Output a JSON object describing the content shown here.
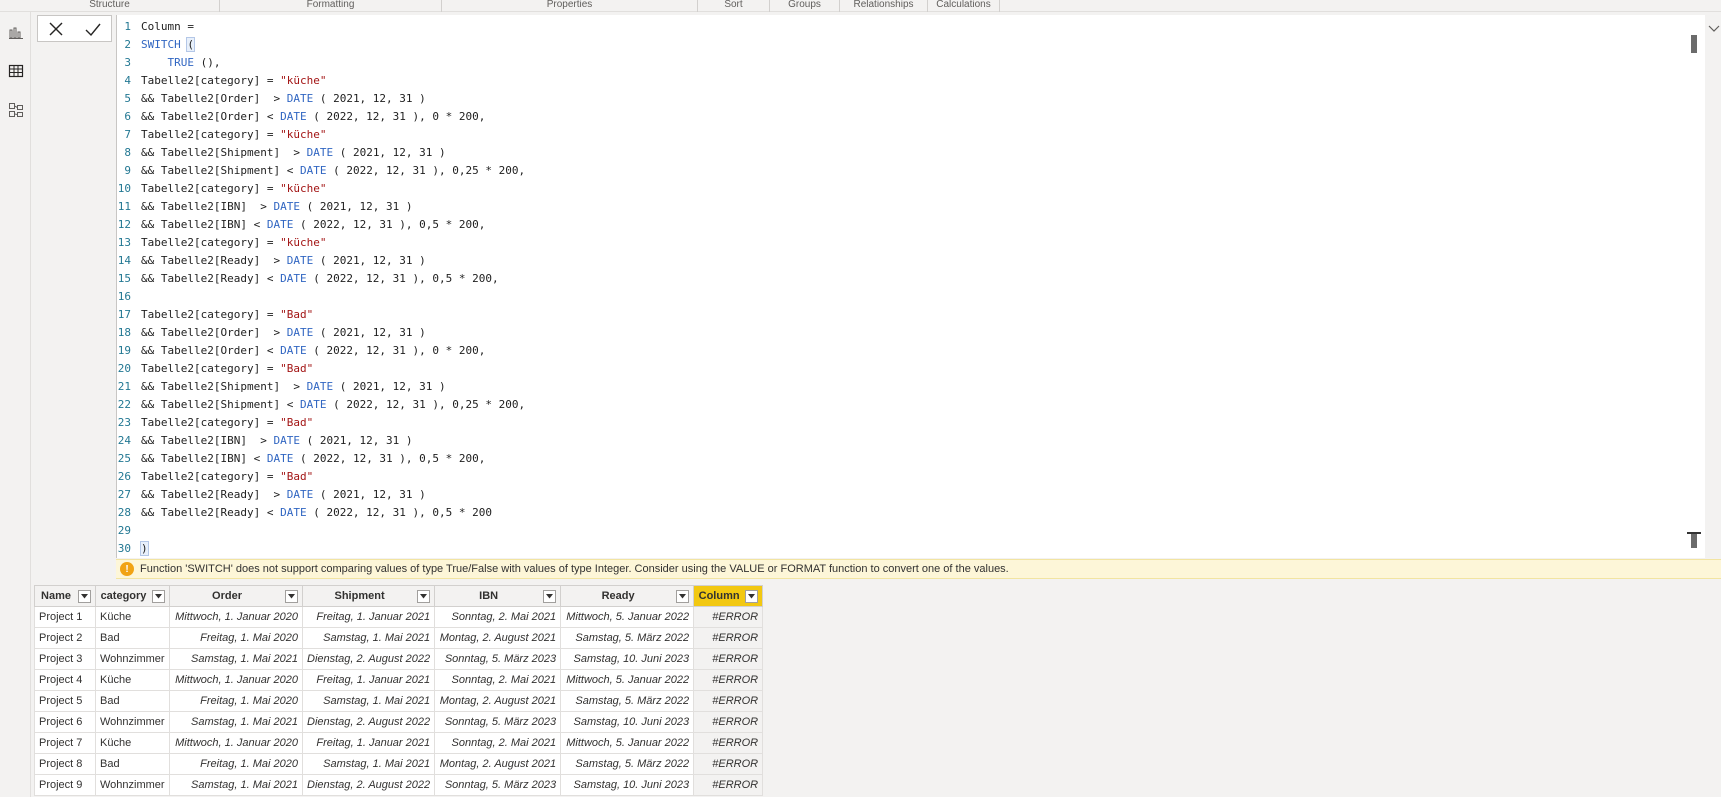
{
  "ribbon": {
    "groups": [
      "Structure",
      "Formatting",
      "Properties",
      "Sort",
      "Groups",
      "Relationships",
      "Calculations"
    ]
  },
  "rail": {
    "icons": [
      "report-view-icon",
      "data-view-icon",
      "model-view-icon"
    ]
  },
  "editor": {
    "lines": [
      [
        {
          "t": "Column = ",
          "c": ""
        }
      ],
      [
        {
          "t": "SWITCH ",
          "c": "fn"
        },
        {
          "t": "(",
          "c": "br"
        }
      ],
      [
        {
          "t": "    TRUE ",
          "c": "kw"
        },
        {
          "t": "(),",
          "c": ""
        }
      ],
      [
        {
          "t": "Tabelle2[category] = ",
          "c": ""
        },
        {
          "t": "\"küche\"",
          "c": "str"
        }
      ],
      [
        {
          "t": "&& Tabelle2[Order]  > ",
          "c": ""
        },
        {
          "t": "DATE",
          "c": "fn"
        },
        {
          "t": " ( 2021, 12, 31 )",
          "c": ""
        }
      ],
      [
        {
          "t": "&& Tabelle2[Order] < ",
          "c": ""
        },
        {
          "t": "DATE",
          "c": "fn"
        },
        {
          "t": " ( 2022, 12, 31 ), 0 * 200,",
          "c": ""
        }
      ],
      [
        {
          "t": "Tabelle2[category] = ",
          "c": ""
        },
        {
          "t": "\"küche\"",
          "c": "str"
        }
      ],
      [
        {
          "t": "&& Tabelle2[Shipment]  > ",
          "c": ""
        },
        {
          "t": "DATE",
          "c": "fn"
        },
        {
          "t": " ( 2021, 12, 31 )",
          "c": ""
        }
      ],
      [
        {
          "t": "&& Tabelle2[Shipment] < ",
          "c": ""
        },
        {
          "t": "DATE",
          "c": "fn"
        },
        {
          "t": " ( 2022, 12, 31 ), 0,25 * 200,",
          "c": ""
        }
      ],
      [
        {
          "t": "Tabelle2[category] = ",
          "c": ""
        },
        {
          "t": "\"küche\"",
          "c": "str"
        }
      ],
      [
        {
          "t": "&& Tabelle2[IBN]  > ",
          "c": ""
        },
        {
          "t": "DATE",
          "c": "fn"
        },
        {
          "t": " ( 2021, 12, 31 )",
          "c": ""
        }
      ],
      [
        {
          "t": "&& Tabelle2[IBN] < ",
          "c": ""
        },
        {
          "t": "DATE",
          "c": "fn"
        },
        {
          "t": " ( 2022, 12, 31 ), 0,5 * 200,",
          "c": ""
        }
      ],
      [
        {
          "t": "Tabelle2[category] = ",
          "c": ""
        },
        {
          "t": "\"küche\"",
          "c": "str"
        }
      ],
      [
        {
          "t": "&& Tabelle2[Ready]  > ",
          "c": ""
        },
        {
          "t": "DATE",
          "c": "fn"
        },
        {
          "t": " ( 2021, 12, 31 )",
          "c": ""
        }
      ],
      [
        {
          "t": "&& Tabelle2[Ready] < ",
          "c": ""
        },
        {
          "t": "DATE",
          "c": "fn"
        },
        {
          "t": " ( 2022, 12, 31 ), 0,5 * 200,",
          "c": ""
        }
      ],
      [],
      [
        {
          "t": "Tabelle2[category] = ",
          "c": ""
        },
        {
          "t": "\"Bad\"",
          "c": "str"
        }
      ],
      [
        {
          "t": "&& Tabelle2[Order]  > ",
          "c": ""
        },
        {
          "t": "DATE",
          "c": "fn"
        },
        {
          "t": " ( 2021, 12, 31 )",
          "c": ""
        }
      ],
      [
        {
          "t": "&& Tabelle2[Order] < ",
          "c": ""
        },
        {
          "t": "DATE",
          "c": "fn"
        },
        {
          "t": " ( 2022, 12, 31 ), 0 * 200,",
          "c": ""
        }
      ],
      [
        {
          "t": "Tabelle2[category] = ",
          "c": ""
        },
        {
          "t": "\"Bad\"",
          "c": "str"
        }
      ],
      [
        {
          "t": "&& Tabelle2[Shipment]  > ",
          "c": ""
        },
        {
          "t": "DATE",
          "c": "fn"
        },
        {
          "t": " ( 2021, 12, 31 )",
          "c": ""
        }
      ],
      [
        {
          "t": "&& Tabelle2[Shipment] < ",
          "c": ""
        },
        {
          "t": "DATE",
          "c": "fn"
        },
        {
          "t": " ( 2022, 12, 31 ), 0,25 * 200,",
          "c": ""
        }
      ],
      [
        {
          "t": "Tabelle2[category] = ",
          "c": ""
        },
        {
          "t": "\"Bad\"",
          "c": "str"
        }
      ],
      [
        {
          "t": "&& Tabelle2[IBN]  > ",
          "c": ""
        },
        {
          "t": "DATE",
          "c": "fn"
        },
        {
          "t": " ( 2021, 12, 31 )",
          "c": ""
        }
      ],
      [
        {
          "t": "&& Tabelle2[IBN] < ",
          "c": ""
        },
        {
          "t": "DATE",
          "c": "fn"
        },
        {
          "t": " ( 2022, 12, 31 ), 0,5 * 200,",
          "c": ""
        }
      ],
      [
        {
          "t": "Tabelle2[category] = ",
          "c": ""
        },
        {
          "t": "\"Bad\"",
          "c": "str"
        }
      ],
      [
        {
          "t": "&& Tabelle2[Ready]  > ",
          "c": ""
        },
        {
          "t": "DATE",
          "c": "fn"
        },
        {
          "t": " ( 2021, 12, 31 )",
          "c": ""
        }
      ],
      [
        {
          "t": "&& Tabelle2[Ready] < ",
          "c": ""
        },
        {
          "t": "DATE",
          "c": "fn"
        },
        {
          "t": " ( 2022, 12, 31 ), 0,5 * 200",
          "c": ""
        }
      ],
      [],
      [
        {
          "t": ")",
          "c": "br"
        }
      ]
    ]
  },
  "error": {
    "message": "Function 'SWITCH' does not support comparing values of type True/False with values of type Integer. Consider using the VALUE or FORMAT function to convert one of the values."
  },
  "table": {
    "columns": [
      "Name",
      "category",
      "Order",
      "Shipment",
      "IBN",
      "Ready",
      "Column"
    ],
    "selected_column": "Column",
    "rows": [
      [
        "Project 1",
        "Küche",
        "Mittwoch, 1. Januar 2020",
        "Freitag, 1. Januar 2021",
        "Sonntag, 2. Mai 2021",
        "Mittwoch, 5. Januar 2022",
        "#ERROR"
      ],
      [
        "Project 2",
        "Bad",
        "Freitag, 1. Mai 2020",
        "Samstag, 1. Mai 2021",
        "Montag, 2. August 2021",
        "Samstag, 5. März 2022",
        "#ERROR"
      ],
      [
        "Project 3",
        "Wohnzimmer",
        "Samstag, 1. Mai 2021",
        "Dienstag, 2. August 2022",
        "Sonntag, 5. März 2023",
        "Samstag, 10. Juni 2023",
        "#ERROR"
      ],
      [
        "Project 4",
        "Küche",
        "Mittwoch, 1. Januar 2020",
        "Freitag, 1. Januar 2021",
        "Sonntag, 2. Mai 2021",
        "Mittwoch, 5. Januar 2022",
        "#ERROR"
      ],
      [
        "Project 5",
        "Bad",
        "Freitag, 1. Mai 2020",
        "Samstag, 1. Mai 2021",
        "Montag, 2. August 2021",
        "Samstag, 5. März 2022",
        "#ERROR"
      ],
      [
        "Project 6",
        "Wohnzimmer",
        "Samstag, 1. Mai 2021",
        "Dienstag, 2. August 2022",
        "Sonntag, 5. März 2023",
        "Samstag, 10. Juni 2023",
        "#ERROR"
      ],
      [
        "Project 7",
        "Küche",
        "Mittwoch, 1. Januar 2020",
        "Freitag, 1. Januar 2021",
        "Sonntag, 2. Mai 2021",
        "Mittwoch, 5. Januar 2022",
        "#ERROR"
      ],
      [
        "Project 8",
        "Bad",
        "Freitag, 1. Mai 2020",
        "Samstag, 1. Mai 2021",
        "Montag, 2. August 2021",
        "Samstag, 5. März 2022",
        "#ERROR"
      ],
      [
        "Project 9",
        "Wohnzimmer",
        "Samstag, 1. Mai 2021",
        "Dienstag, 2. August 2022",
        "Sonntag, 5. März 2023",
        "Samstag, 10. Juni 2023",
        "#ERROR"
      ]
    ]
  },
  "colors": {
    "selected_header": "#f2c811",
    "error_bar": "#fdf6d8",
    "warning": "#f1a314",
    "keyword": "#3166c2",
    "string": "#a31515",
    "line_number": "#237893"
  }
}
